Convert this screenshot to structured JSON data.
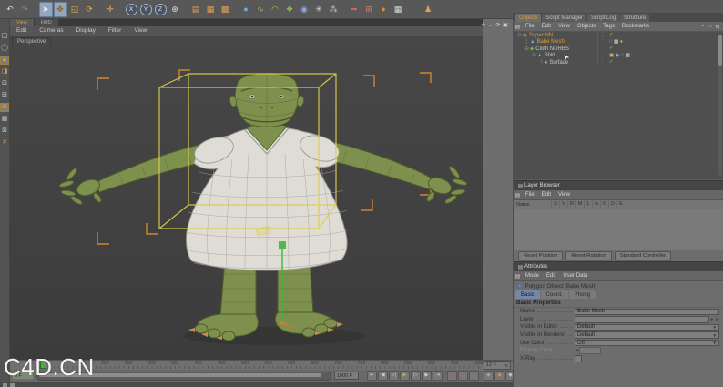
{
  "watermark": "C4D.CN",
  "colors": {
    "accent_orange": "#d89a35",
    "selection_yellow": "#dccf4a",
    "bracket_orange": "#d98a2c",
    "check_green": "#8ace5e",
    "axis_green": "#3db83d",
    "active_tab_blue": "#7388aa"
  },
  "top_toolbar": {
    "icons": [
      {
        "name": "undo-icon",
        "glyph": "↶",
        "c": "#d8d8d8"
      },
      {
        "name": "redo-icon",
        "glyph": "↷",
        "c": "#8f8f8f"
      },
      {
        "cls": "gap"
      },
      {
        "name": "live-selection-icon",
        "glyph": "➤",
        "c": "#eeeeee",
        "cls": "on"
      },
      {
        "name": "move-tool-icon",
        "glyph": "✥",
        "c": "#8a5f10",
        "cls": "on"
      },
      {
        "name": "scale-tool-icon",
        "glyph": "◱",
        "c": "#e6b13e"
      },
      {
        "name": "rotate-tool-icon",
        "glyph": "⟳",
        "c": "#e6b13e"
      },
      {
        "cls": "gap"
      },
      {
        "name": "last-tool-icon",
        "glyph": "✛",
        "c": "#e6b13e"
      },
      {
        "cls": "gap"
      },
      {
        "name": "x-axis-lock-icon",
        "glyph": "X",
        "cls": "circ"
      },
      {
        "name": "y-axis-lock-icon",
        "glyph": "Y",
        "cls": "circ"
      },
      {
        "name": "z-axis-lock-icon",
        "glyph": "Z",
        "cls": "circ"
      },
      {
        "name": "coord-system-icon",
        "glyph": "⊕",
        "c": "#d8d8d8"
      },
      {
        "cls": "gap"
      },
      {
        "name": "render-view-icon",
        "glyph": "▤",
        "c": "#e0a050"
      },
      {
        "name": "render-region-icon",
        "glyph": "▦",
        "c": "#e0a050"
      },
      {
        "name": "render-settings-icon",
        "glyph": "▩",
        "c": "#e0a050"
      },
      {
        "cls": "gap"
      },
      {
        "name": "add-primitive-icon",
        "glyph": "●",
        "c": "#6aaede"
      },
      {
        "name": "add-spline-icon",
        "glyph": "∿",
        "c": "#9cc455"
      },
      {
        "name": "add-nurbs-icon",
        "glyph": "◠",
        "c": "#9cc455"
      },
      {
        "name": "add-modeling-icon",
        "glyph": "❖",
        "c": "#9cc455"
      },
      {
        "name": "add-deformer-icon",
        "glyph": "◉",
        "c": "#8fa8e0"
      },
      {
        "name": "add-instance-icon",
        "glyph": "✳",
        "c": "#d8d8d8"
      },
      {
        "name": "add-particles-icon",
        "glyph": "⁂",
        "c": "#cfcfcf"
      },
      {
        "cls": "gap"
      },
      {
        "name": "key-tool-icon",
        "glyph": "➥",
        "c": "#cf6a50"
      },
      {
        "name": "spreadsheet-icon",
        "glyph": "⊞",
        "c": "#cf7a70"
      },
      {
        "name": "sky-object-icon",
        "glyph": "●",
        "c": "#de8a35"
      },
      {
        "name": "layout-icon",
        "glyph": "▦",
        "c": "#d8d8d8"
      },
      {
        "cls": "gap2"
      },
      {
        "name": "character-icon",
        "glyph": "♟",
        "c": "#e0a060"
      }
    ]
  },
  "left_toolbar": {
    "icons": [
      {
        "name": "make-editable-icon",
        "glyph": "◱",
        "c": "#d5d5d5"
      },
      {
        "name": "model-mode-icon",
        "glyph": "◯",
        "c": "#b5b5b5"
      },
      {
        "name": "object-axis-icon",
        "glyph": "▲",
        "c": "#d8b050",
        "cls": "on"
      },
      {
        "name": "texture-mode-icon",
        "glyph": "◨",
        "c": "#c8a868"
      },
      {
        "name": "points-mode-icon",
        "glyph": "⊡",
        "c": "#d5d5d5"
      },
      {
        "name": "edges-mode-icon",
        "glyph": "⊟",
        "c": "#d5d5d5"
      },
      {
        "name": "polygons-mode-icon",
        "glyph": "⊞",
        "c": "#e8953a",
        "cls": "on"
      },
      {
        "name": "texture-axis-icon",
        "glyph": "▦",
        "c": "#c5c5c5"
      },
      {
        "name": "selection-mask-icon",
        "glyph": "⊠",
        "c": "#c5c5c5"
      },
      {
        "name": "snap-settings-icon",
        "glyph": "✕",
        "c": "#e8953a"
      }
    ]
  },
  "viewport": {
    "tabs": [
      {
        "name": "viewport-tab-view",
        "label": "View",
        "cls": "act"
      },
      {
        "name": "viewport-tab-hud",
        "label": "HUD"
      }
    ],
    "menu": [
      {
        "name": "vp-menu-edit",
        "label": "Edit"
      },
      {
        "name": "vp-menu-cameras",
        "label": "Cameras"
      },
      {
        "name": "vp-menu-display",
        "label": "Display"
      },
      {
        "name": "vp-menu-filter",
        "label": "Filter"
      },
      {
        "name": "vp-menu-view",
        "label": "View"
      }
    ],
    "nav_icons": [
      {
        "name": "pan-view-icon",
        "glyph": "✛"
      },
      {
        "name": "zoom-view-icon",
        "glyph": "↔"
      },
      {
        "name": "rotate-view-icon",
        "glyph": "⟳"
      },
      {
        "name": "toggle-view-icon",
        "glyph": "▣"
      }
    ],
    "camera_label": "Perspective"
  },
  "timeline": {
    "ticks": [
      "150",
      "200",
      "250",
      "300",
      "350",
      "400",
      "450",
      "500",
      "550",
      "600",
      "650",
      "700",
      "750",
      "800",
      "850",
      "900",
      "950",
      "1000"
    ],
    "current_frame": "12 F",
    "start_frame": "0 F",
    "end_frame": "1000 F",
    "playback_icons": [
      {
        "name": "goto-start-button",
        "glyph": "⇤"
      },
      {
        "name": "prev-key-button",
        "glyph": "◀"
      },
      {
        "name": "prev-frame-button",
        "glyph": "◁"
      },
      {
        "name": "play-button",
        "glyph": "▶",
        "c": "#8fbf6a"
      },
      {
        "name": "next-frame-button",
        "glyph": "▷"
      },
      {
        "name": "next-key-button",
        "glyph": "▶"
      },
      {
        "name": "goto-end-button",
        "glyph": "⇥"
      }
    ],
    "record_icons": [
      {
        "name": "record-keyframe-button",
        "glyph": "●",
        "c": "#c45353"
      },
      {
        "name": "autokey-button",
        "glyph": "●",
        "c": "#c45353"
      },
      {
        "name": "record-options-button",
        "glyph": "◐",
        "c": "#c45353"
      }
    ],
    "toggle_icons": [
      {
        "name": "record-position-toggle",
        "glyph": "◆",
        "c": "#8fa6c6"
      },
      {
        "name": "record-scale-toggle",
        "glyph": "◆",
        "c": "#d28f45"
      },
      {
        "name": "record-rotation-toggle",
        "glyph": "◆",
        "c": "#c2c2c2"
      },
      {
        "name": "record-parameter-toggle",
        "glyph": "⊡",
        "c": "#c2c2c2"
      }
    ],
    "end_icons": [
      {
        "name": "solo-toggle",
        "glyph": "◉"
      },
      {
        "name": "expand-timeline-button",
        "glyph": "▲"
      }
    ]
  },
  "object_manager": {
    "tabs": [
      {
        "name": "tab-objects",
        "label": "Objects",
        "cls": "act"
      },
      {
        "name": "tab-script-manager",
        "label": "Script Manager"
      },
      {
        "name": "tab-script-log",
        "label": "Script Log"
      },
      {
        "name": "tab-structure",
        "label": "Structure"
      }
    ],
    "menu": [
      {
        "name": "om-menu-file",
        "label": "File"
      },
      {
        "name": "om-menu-edit",
        "label": "Edit"
      },
      {
        "name": "om-menu-view",
        "label": "View"
      },
      {
        "name": "om-menu-objects",
        "label": "Objects"
      },
      {
        "name": "om-menu-tags",
        "label": "Tags"
      },
      {
        "name": "om-menu-bookmarks",
        "label": "Bookmarks"
      }
    ],
    "right_icons": [
      {
        "name": "search-icon",
        "glyph": "⌖"
      },
      {
        "name": "home-icon",
        "glyph": "⌂"
      },
      {
        "name": "swap-icon",
        "glyph": "⇆"
      }
    ],
    "rows": [
      {
        "label": "Super HN",
        "expand": "⊟",
        "icon_glyph": "◉",
        "tags": [
          {
            "name": "enabled-check-icon",
            "glyph": "✓",
            "c": "#8ace5e"
          }
        ]
      },
      {
        "label": "Babe Mesh",
        "expand": "",
        "icon_glyph": "▲",
        "tags": [
          {
            "name": "selection-tag-icon",
            "glyph": "∷",
            "c": "#e09a40"
          },
          {
            "name": "texture-tag-icon",
            "glyph": "▩",
            "c": "#d8d8d8"
          },
          {
            "name": "material-tag-icon",
            "glyph": "●",
            "c": "#aabf3e"
          }
        ]
      },
      {
        "label": "Cloth NURBS",
        "expand": "⊟",
        "icon_glyph": "◆",
        "tags": [
          {
            "name": "enabled-check-icon",
            "glyph": "✓",
            "c": "#8ace5e"
          }
        ]
      },
      {
        "label": "Shirt",
        "expand": "⊟",
        "icon_glyph": "▲",
        "tags": [
          {
            "name": "highlight-tag-icon",
            "glyph": "▣",
            "c": "#e8b84a"
          },
          {
            "name": "cloth-tag-icon",
            "glyph": "◆",
            "c": "#7aa8e0"
          },
          {
            "name": "selection-tag-icon",
            "glyph": "∷",
            "c": "#e09a40"
          },
          {
            "name": "texture-tag-icon",
            "glyph": "▩",
            "c": "#d8d8d8"
          }
        ]
      },
      {
        "label": "Surface",
        "expand": "└",
        "icon_glyph": "●",
        "tags": [
          {
            "name": "enabled-check-icon",
            "glyph": "✓",
            "c": "#8ace5e"
          }
        ]
      }
    ]
  },
  "layer_browser": {
    "title": "Layer Browser",
    "menu": [
      {
        "name": "lb-menu-file",
        "label": "File"
      },
      {
        "name": "lb-menu-edit",
        "label": "Edit"
      },
      {
        "name": "lb-menu-view",
        "label": "View"
      }
    ],
    "name_header": "Name",
    "column_letters": [
      "S",
      "V",
      "R",
      "M",
      "L",
      "A",
      "G",
      "D",
      "E"
    ]
  },
  "controller_buttons": {
    "b1": "Reset Position",
    "b2": "Reset Rotation",
    "b3": "Standard Controller"
  },
  "attributes": {
    "title": "Attributes",
    "menu": [
      {
        "name": "attr-menu-mode",
        "label": "Mode"
      },
      {
        "name": "attr-menu-edit",
        "label": "Edit"
      },
      {
        "name": "attr-menu-userdata",
        "label": "User Data"
      }
    ],
    "right_icons": [
      {
        "name": "back-icon",
        "glyph": "◀",
        "c": "#9a9a9a"
      },
      {
        "name": "forward-icon",
        "glyph": "▶",
        "c": "#9a9a9a"
      },
      {
        "name": "up-icon",
        "glyph": "▲"
      },
      {
        "name": "search-icon",
        "glyph": "⌖"
      },
      {
        "name": "list-icon",
        "glyph": "▤"
      }
    ],
    "object_title": "Polygon Object [Babe Mesh]",
    "tabs": [
      {
        "name": "tab-basic",
        "label": "Basic",
        "cls": "act"
      },
      {
        "name": "tab-coord",
        "label": "Coord."
      },
      {
        "name": "tab-phong",
        "label": "Phong"
      }
    ],
    "section": "Basic Properties",
    "labels": {
      "name": "Name",
      "layer": "Layer",
      "visible_editor": "Visible in Editor",
      "visible_renderer": "Visible in Renderer",
      "use_color": "Use Color",
      "display_color": "Display Color",
      "xray": "X-Ray"
    },
    "values": {
      "name": "Babe Mesh",
      "layer": "",
      "visible_editor": "Default",
      "visible_renderer": "Default",
      "use_color": "Off"
    }
  }
}
